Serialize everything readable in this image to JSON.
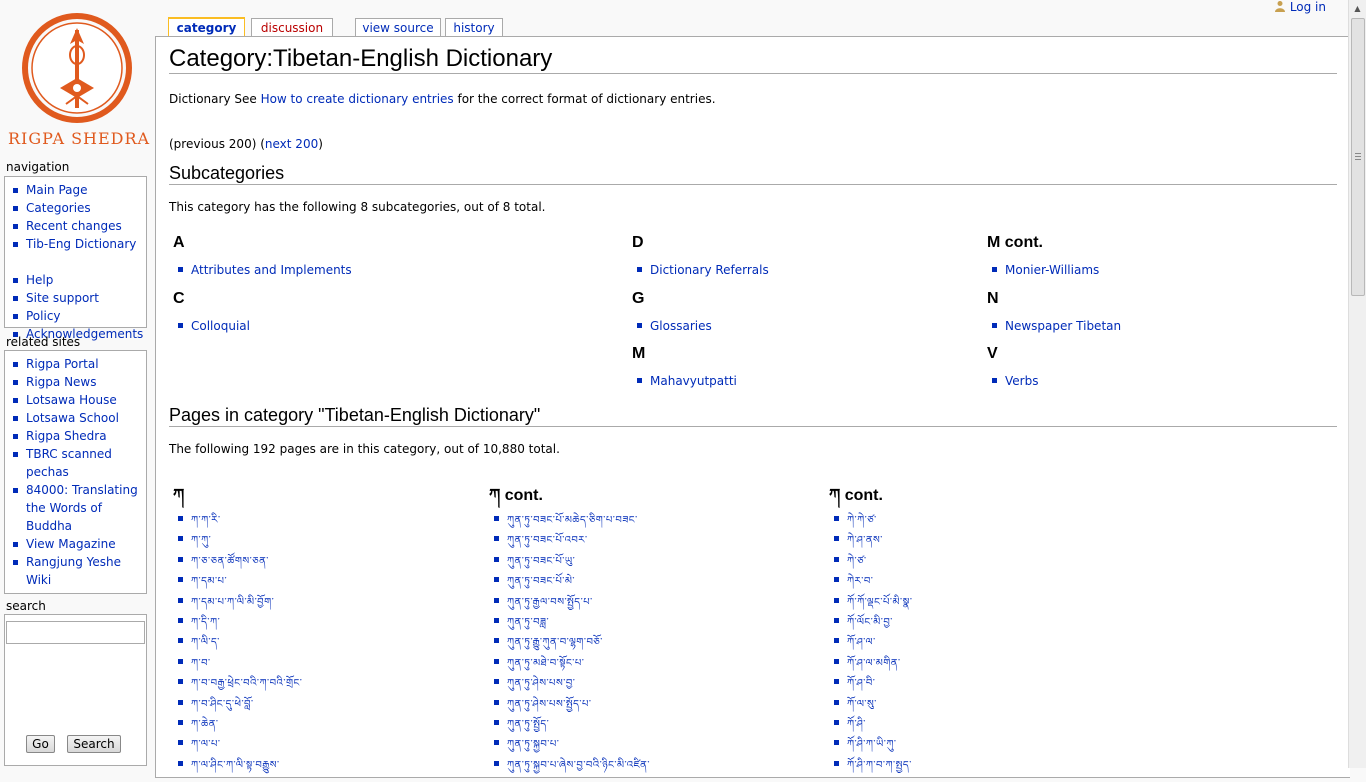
{
  "site": {
    "name": "RIGPA SHEDRA",
    "accent": "#e05a1e"
  },
  "user": {
    "login_label": "Log in"
  },
  "tabs": [
    {
      "label": "category",
      "selected": true
    },
    {
      "label": "discussion",
      "red": true
    },
    {
      "label": "view source"
    },
    {
      "label": "history"
    }
  ],
  "page": {
    "title": "Category:Tibetan-English Dictionary",
    "intro_prefix": "Dictionary See ",
    "intro_link": "How to create dictionary entries",
    "intro_suffix": " for the correct format of dictionary entries.",
    "nav_prev": "(previous 200)",
    "nav_next_open": "(",
    "nav_next": "next 200",
    "nav_next_close": ")",
    "subcats_heading": "Subcategories",
    "subcats_summary": "This category has the following 8 subcategories, out of 8 total.",
    "pages_heading": "Pages in category \"Tibetan-English Dictionary\"",
    "pages_summary": "The following 192 pages are in this category, out of 10,880 total."
  },
  "subcategories": {
    "col1": [
      {
        "letter": "A",
        "items": [
          "Attributes and Implements"
        ]
      },
      {
        "letter": "C",
        "items": [
          "Colloquial"
        ]
      }
    ],
    "col2": [
      {
        "letter": "D",
        "items": [
          "Dictionary Referrals"
        ]
      },
      {
        "letter": "G",
        "items": [
          "Glossaries"
        ]
      },
      {
        "letter": "M",
        "items": [
          "Mahavyutpatti"
        ]
      }
    ],
    "col3": [
      {
        "letter": "M cont.",
        "items": [
          "Monier-Williams"
        ]
      },
      {
        "letter": "N",
        "items": [
          "Newspaper Tibetan"
        ]
      },
      {
        "letter": "V",
        "items": [
          "Verbs"
        ]
      }
    ]
  },
  "pages": {
    "col1_heading": "ཀ",
    "col2_heading": "ཀ cont.",
    "col3_heading": "ཀ cont.",
    "col1": [
      "ཀ་ཀ་རི་",
      "ཀ་ཀུ་",
      "ཀ་ཅ་ཅན་ཚོགས་ཅན་",
      "ཀ་དམ་པ་",
      "ཀ་དམ་པ་ཀ་ལི་མི་བྱོག་",
      "ཀ་དི་ཀ་",
      "ཀ་ལི་ད་",
      "ཀ་བ་",
      "ཀ་བ་བརྒྱ་ཕྲེང་བའི་ཀ་བའི་གྲོང་",
      "ཀ་བ་ཤིང་དུ་ཕེ་བློ་",
      "ཀ་ཆེན་",
      "ཀ་ལ་པ་",
      "ཀ་ལ་ཤིང་ཀ་ལི་སྟ་བརྒྱུས་"
    ],
    "col2": [
      "ཀུན་ཏུ་བཟང་པོ་མཆེད་ཅིག་པ་བཟང་",
      "ཀུན་ཏུ་བཟང་པོ་འབར་",
      "ཀུན་ཏུ་བཟང་པོ་ཡུ་",
      "ཀུན་ཏུ་བཟང་པོ་མེ་",
      "ཀུན་ཏུ་རྒྱལ་བས་སྤྱོད་པ་",
      "ཀུན་ཏུ་བཟླ་",
      "ཀུན་ཏུ་རྒྱུ་ཀུན་བ་ལྷག་བཅོ་",
      "ཀུན་ཏུ་མཐེ་བ་སྟོང་པ་",
      "ཀུན་ཏུ་ཤེས་པས་བྱ་",
      "ཀུན་ཏུ་ཤེས་པས་སྤྱོད་པ་",
      "ཀུན་ཏུ་སྤྱོད་",
      "ཀུན་ཏུ་སྐྱབ་པ་",
      "ཀུན་ཏུ་སྐྱབ་པ་ཞེས་བྱ་བའི་ཉིང་མི་འཛིན་"
    ],
    "col3": [
      "ཀེ་ཀེ་ཙ་",
      "ཀེ་ཤ་ནས་",
      "ཀེ་ཙ་",
      "ཀེར་བ་",
      "ཀོ་ཀོ་ལྡང་པོ་མི་སྣ་",
      "ཀོ་ལོང་མི་བྱ་",
      "ཀོ་ཤ་ལ་",
      "ཀོ་ཤ་ལ་མགིན་",
      "ཀོ་ཤ་བི་",
      "ཀོ་ལ་སུ་",
      "ཀོ་ཤི་",
      "ཀོ་ཤི་ཀ་ཡི་ཀུ་",
      "ཀོ་ཤི་ཀ་བ་ཀ་སྤྱད་"
    ]
  },
  "sidebar": {
    "navigation_title": "navigation",
    "navigation": [
      "Main Page",
      "Categories",
      "Recent changes",
      "Tib-Eng Dictionary",
      "Help",
      "Site support",
      "Policy",
      "Acknowledgements"
    ],
    "related_title": "related sites",
    "related": [
      "Rigpa Portal",
      "Rigpa News",
      "Lotsawa House",
      "Lotsawa School",
      "Rigpa Shedra",
      "TBRC scanned pechas",
      "84000: Translating the Words of Buddha",
      "View Magazine",
      "Rangjung Yeshe Wiki"
    ],
    "search_title": "search",
    "search_value": "",
    "go_label": "Go",
    "search_label": "Search"
  }
}
